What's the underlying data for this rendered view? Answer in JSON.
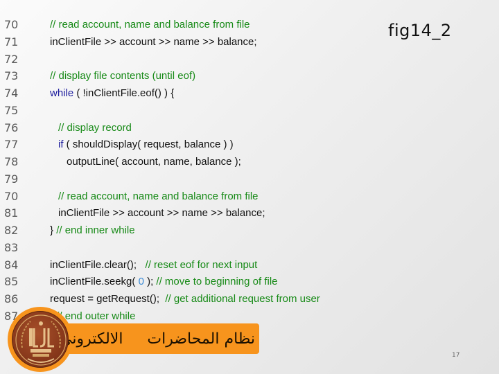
{
  "slide": {
    "figure_label": "fig14_2",
    "page_number": "17"
  },
  "code": {
    "lines": [
      {
        "number": "70",
        "indent": 0,
        "tokens": [
          {
            "t": "// read account, name and balance from file",
            "k": "comment"
          }
        ]
      },
      {
        "number": "71",
        "indent": 0,
        "tokens": [
          {
            "t": "inClientFile >> account >> name >> balance;",
            "k": "code"
          }
        ]
      },
      {
        "number": "72",
        "indent": 0,
        "tokens": []
      },
      {
        "number": "73",
        "indent": 0,
        "tokens": [
          {
            "t": "// display file contents (until eof)",
            "k": "comment"
          }
        ]
      },
      {
        "number": "74",
        "indent": 0,
        "tokens": [
          {
            "t": "while",
            "k": "keyword"
          },
          {
            "t": " ( !inClientFile.eof() ) {",
            "k": "code"
          }
        ]
      },
      {
        "number": "75",
        "indent": 0,
        "tokens": []
      },
      {
        "number": "76",
        "indent": 1,
        "tokens": [
          {
            "t": "// display record",
            "k": "comment"
          }
        ]
      },
      {
        "number": "77",
        "indent": 1,
        "tokens": [
          {
            "t": "if",
            "k": "keyword"
          },
          {
            "t": " ( shouldDisplay( request, balance ) )",
            "k": "code"
          }
        ]
      },
      {
        "number": "78",
        "indent": 2,
        "tokens": [
          {
            "t": "outputLine( account, name, balance );",
            "k": "code"
          }
        ]
      },
      {
        "number": "79",
        "indent": 0,
        "tokens": []
      },
      {
        "number": "70",
        "indent": 1,
        "tokens": [
          {
            "t": "// read account, name and balance from file",
            "k": "comment"
          }
        ]
      },
      {
        "number": "81",
        "indent": 1,
        "tokens": [
          {
            "t": "inClientFile >> account >> name >> balance;",
            "k": "code"
          }
        ]
      },
      {
        "number": "82",
        "indent": 0,
        "tokens": [
          {
            "t": "} ",
            "k": "code"
          },
          {
            "t": "// end inner while",
            "k": "comment"
          }
        ]
      },
      {
        "number": "83",
        "indent": 0,
        "tokens": []
      },
      {
        "number": "84",
        "indent": 0,
        "tokens": [
          {
            "t": "inClientFile.clear();   ",
            "k": "code"
          },
          {
            "t": "// reset eof for next input",
            "k": "comment"
          }
        ]
      },
      {
        "number": "85",
        "indent": 0,
        "tokens": [
          {
            "t": "inClientFile.seekg( ",
            "k": "code"
          },
          {
            "t": "0",
            "k": "number"
          },
          {
            "t": " ); ",
            "k": "code"
          },
          {
            "t": "// move to beginning of file",
            "k": "comment"
          }
        ]
      },
      {
        "number": "86",
        "indent": 0,
        "tokens": [
          {
            "t": "request = getRequest();  ",
            "k": "code"
          },
          {
            "t": "// get additional request from user",
            "k": "comment"
          }
        ]
      },
      {
        "number": "87",
        "indent": 0,
        "tokens": [
          {
            "t": "} ",
            "k": "code"
          },
          {
            "t": "// end outer while",
            "k": "comment"
          }
        ]
      }
    ]
  },
  "banner": {
    "text": "نظام المحاضرات     الالكتروني",
    "color": "#f7941d"
  },
  "logo": {
    "icon": "university-seal-icon"
  },
  "colors": {
    "comment": "#178a17",
    "keyword": "#1a1a9c",
    "number": "#3a8ad6",
    "code": "#111111",
    "line_number": "#585858"
  }
}
